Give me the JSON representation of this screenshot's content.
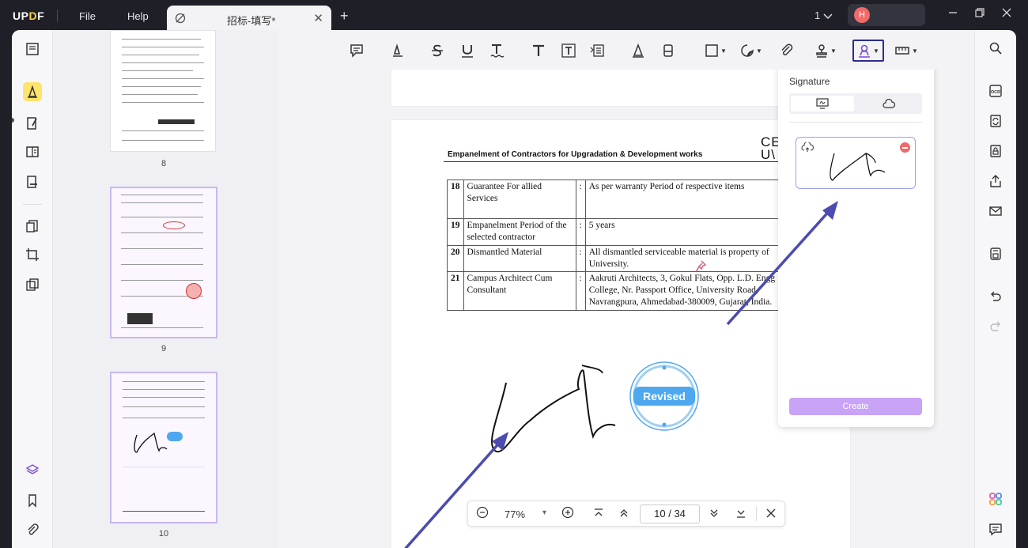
{
  "app": {
    "logo_prefix": "UP",
    "logo_d": "D",
    "logo_suffix": "F",
    "menu": {
      "file": "File",
      "help": "Help"
    },
    "tab_title": "招标-填写*",
    "tab_close": "✕",
    "new_tab": "+",
    "page_indicator": "1",
    "user_initial": "H"
  },
  "thumbnails": [
    {
      "label": "8"
    },
    {
      "label": "9"
    },
    {
      "label": "10"
    }
  ],
  "document": {
    "header": "Empanelment of Contractors for Upgradation & Development works",
    "logo_text_1": "CE",
    "logo_text_2": "U\\",
    "rows": [
      {
        "no": "18",
        "label": "Guarantee For allied Services",
        "colon": ":",
        "value": "As per warranty Period of respective items"
      },
      {
        "no": "19",
        "label": "Empanelment Period of the selected contractor",
        "colon": ":",
        "value": "5 years"
      },
      {
        "no": "20",
        "label": "Dismantled Material",
        "colon": ":",
        "value": "All dismantled serviceable material is property of University."
      },
      {
        "no": "21",
        "label": "Campus Architect Cum Consultant",
        "colon": ":",
        "value": "Aakruti Architects, 3, Gokul Flats, Opp. L.D. Engg College, Nr. Passport Office, University Road, Navrangpura, Ahmedabad-380009, Gujarat, India."
      }
    ],
    "stamp": "Revised"
  },
  "signature_panel": {
    "title": "Signature",
    "create_label": "Create"
  },
  "zoom": {
    "zoom_out": "−",
    "value": "77%",
    "caret": "▾",
    "zoom_in": "+",
    "current_page": "10",
    "page_sep": "/",
    "total_pages": "34"
  },
  "colors": {
    "accent": "#c9a3f5",
    "active_tool_border": "#2c2c8c",
    "arrow": "#4b4bb0",
    "highlight_tool": "#ffe36a"
  }
}
